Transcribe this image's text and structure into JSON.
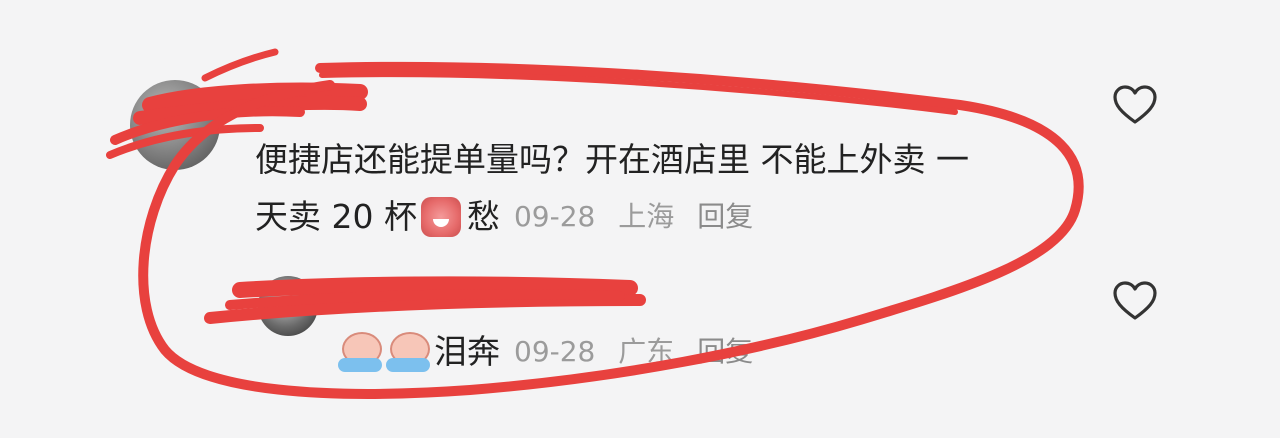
{
  "comments": [
    {
      "text_line1": "便捷店还能提单量吗？开在酒店里 不能上外卖 一",
      "text_line2": "天卖 20 杯",
      "trailing_text": "愁",
      "date": "09-28",
      "location": "上海",
      "reply_label": "回复",
      "emoji": "crying-face-icon"
    },
    {
      "trailing_text": "泪奔",
      "date": "09-28",
      "location": "广东",
      "reply_label": "回复",
      "emoji": "tearful-face-icon"
    }
  ],
  "icons": {
    "like": "heart-outline-icon"
  },
  "colors": {
    "background": "#f4f4f5",
    "annotation_red": "#e8413e",
    "meta_gray": "#9b9b9b"
  }
}
